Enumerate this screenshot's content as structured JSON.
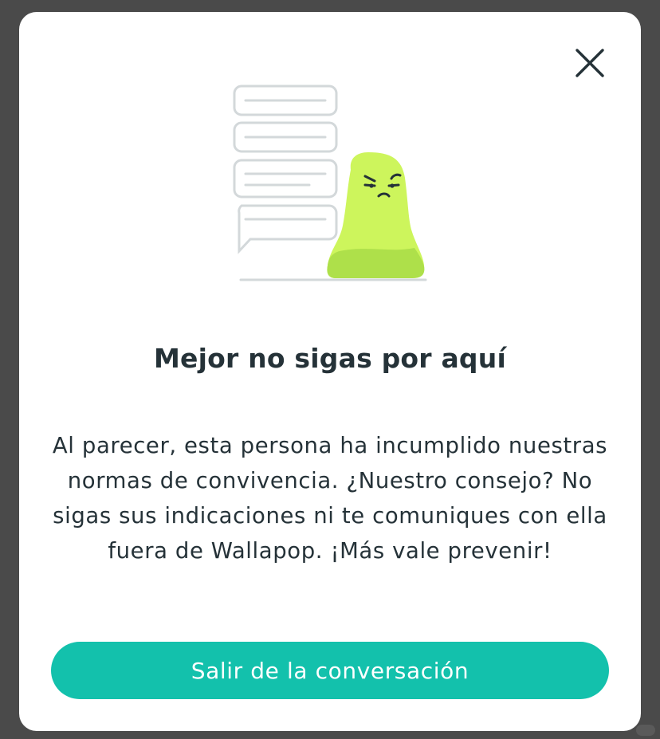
{
  "modal": {
    "title": "Mejor no sigas por aquí",
    "message": "Al parecer, esta persona ha incumplido nuestras normas de convivencia. ¿Nuestro consejo? No sigas sus indicaciones ni te comuniques con ella fuera de Wallapop. ¡Más vale prevenir!",
    "primary_button_label": "Salir de la conversación",
    "close_icon": "close-icon",
    "illustration_icon": "angry-chat-character-illustration"
  },
  "colors": {
    "backdrop": "#4a4a4a",
    "surface": "#ffffff",
    "text": "#253238",
    "accent": "#13c1ac",
    "character": "#cdf55c",
    "character_shade": "#aee04a",
    "bubble_stroke": "#d3d8da"
  }
}
